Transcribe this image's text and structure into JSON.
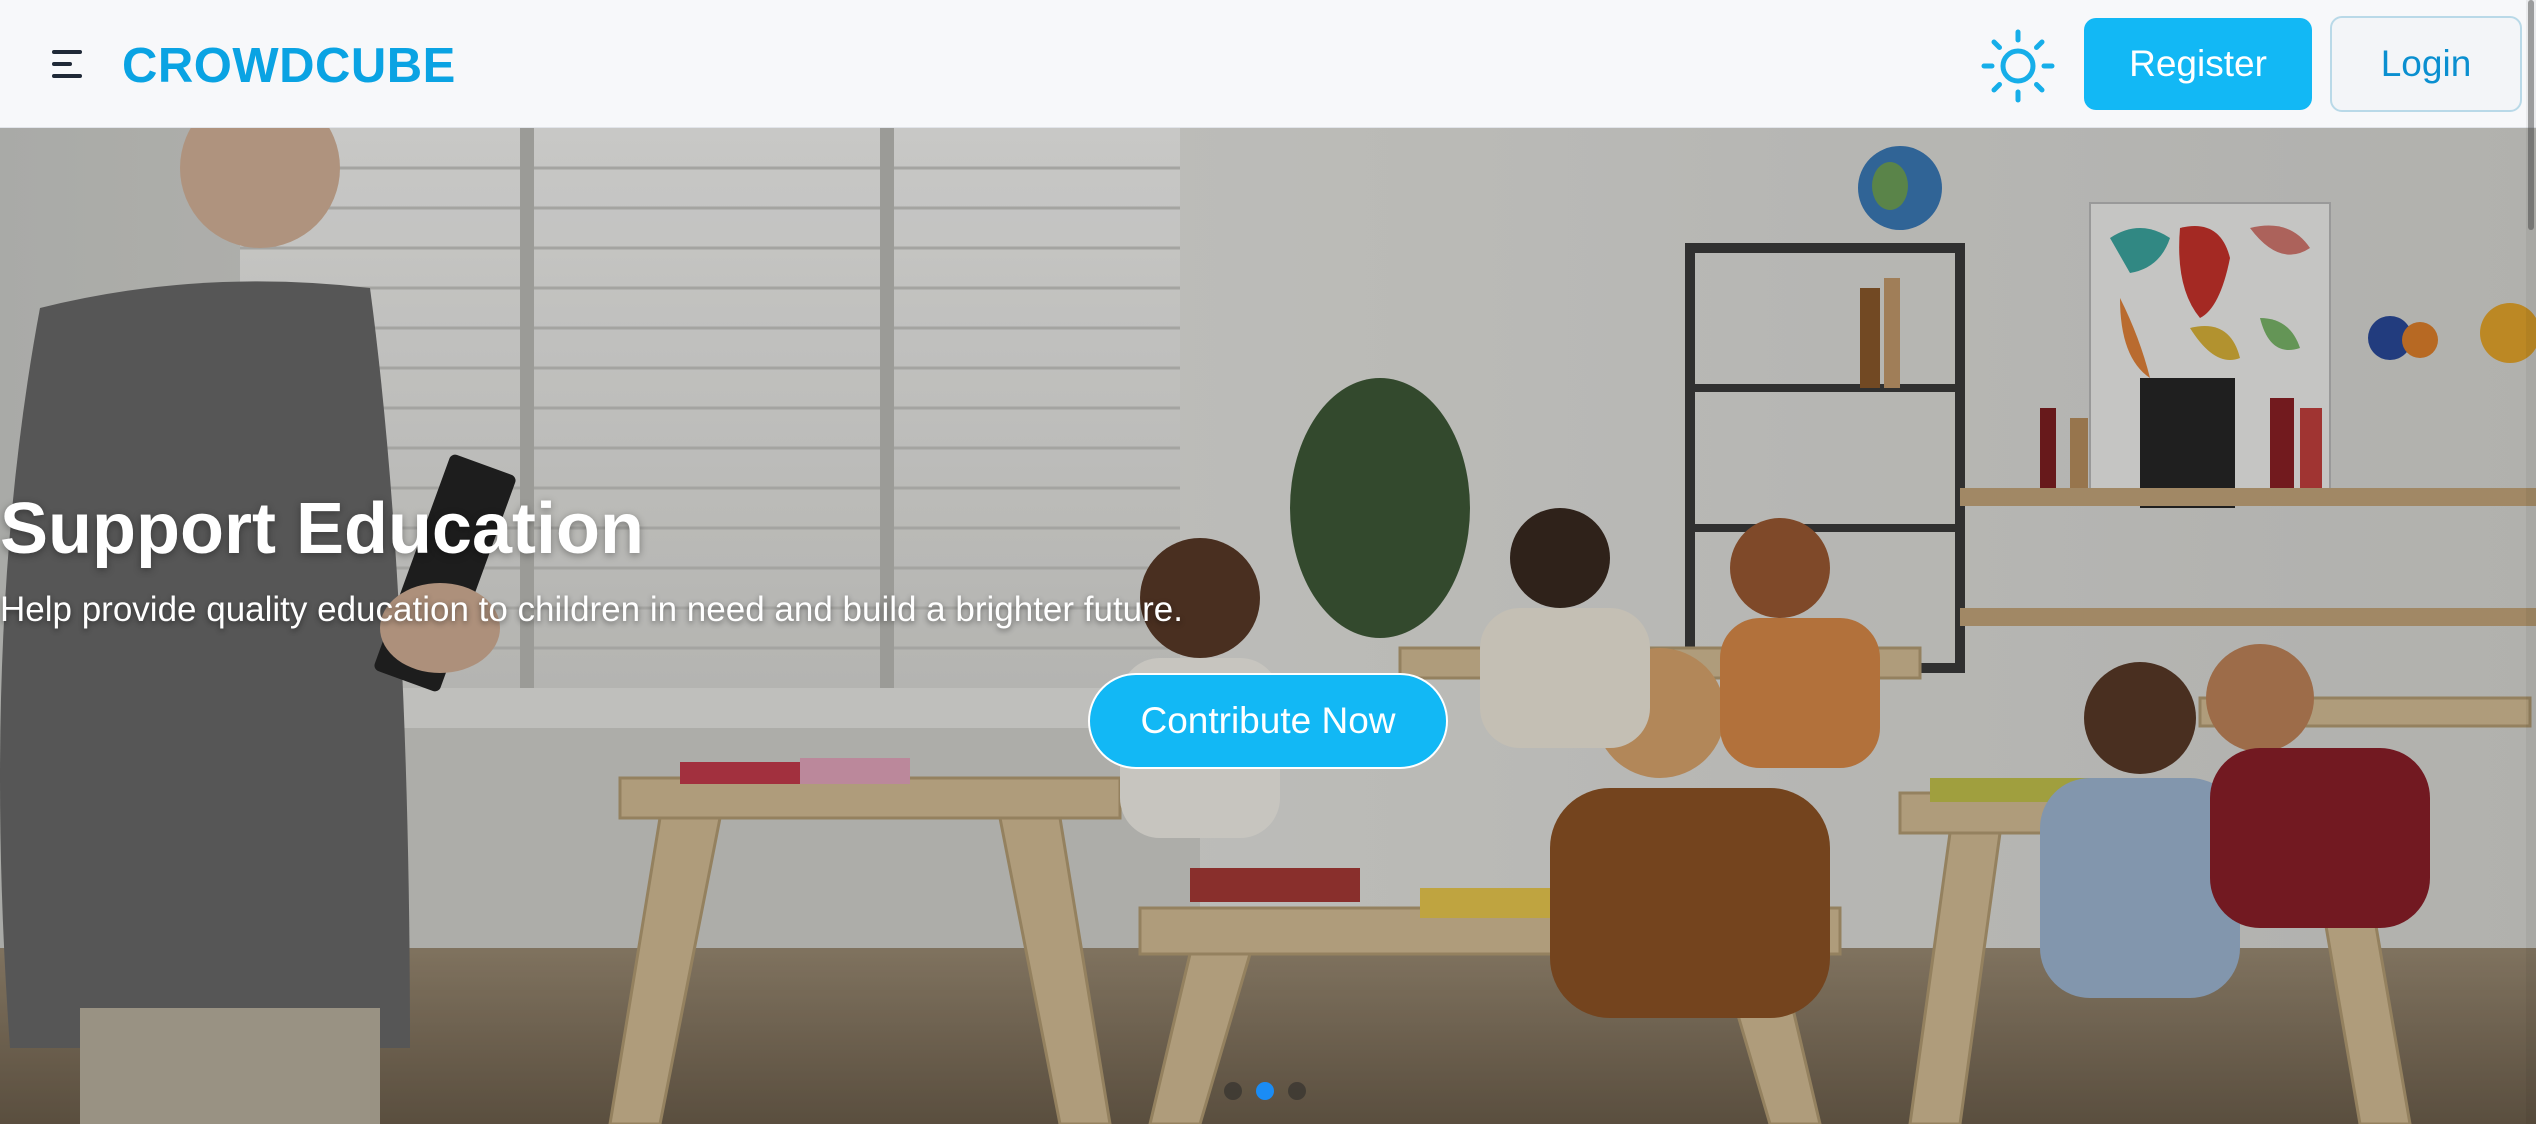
{
  "header": {
    "brand": "CROWDCUBE",
    "menu_icon": "hamburger-menu-icon",
    "theme_icon": "sun-icon",
    "register_label": "Register",
    "login_label": "Login"
  },
  "hero": {
    "title": "Support Education",
    "subtitle": "Help provide quality education to children in need and build a brighter future.",
    "cta_label": "Contribute Now",
    "image_description_icon": "classroom-photo",
    "carousel": {
      "slide_count": 3,
      "active_index": 1
    }
  },
  "colors": {
    "brand": "#0aa3e3",
    "primary_button": "#12b8f5",
    "active_dot": "#1a8cf5"
  }
}
